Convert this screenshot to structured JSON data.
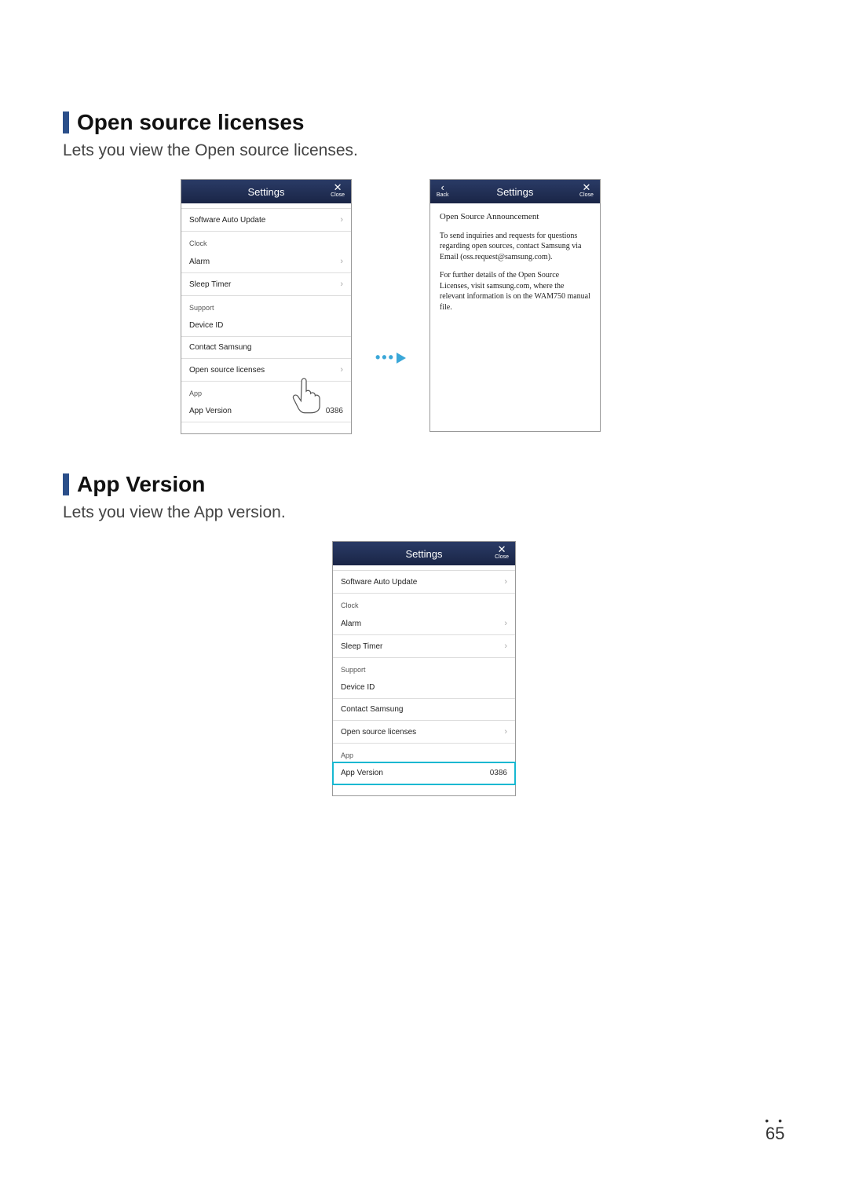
{
  "section1": {
    "title": "Open source licenses",
    "desc": "Lets you view the Open source licenses."
  },
  "section2": {
    "title": "App Version",
    "desc": "Lets you view the App version."
  },
  "settingsScreen": {
    "headerTitle": "Settings",
    "closeLabel": "Close",
    "backLabel": "Back",
    "groups": {
      "g0": {
        "items": {
          "softwareAutoUpdate": "Software Auto Update"
        }
      },
      "clock": {
        "label": "Clock",
        "items": {
          "alarm": "Alarm",
          "sleepTimer": "Sleep Timer"
        }
      },
      "support": {
        "label": "Support",
        "items": {
          "deviceId": "Device ID",
          "contactSamsung": "Contact Samsung",
          "openSource": "Open source licenses"
        }
      },
      "app": {
        "label": "App",
        "items": {
          "appVersion": "App Version",
          "appVersionValue": "0386"
        }
      }
    }
  },
  "ossScreen": {
    "headerTitle": "Settings",
    "announcementTitle": "Open Source Announcement",
    "para1": "To send inquiries and requests for questions regarding open sources, contact Samsung via Email (oss.request@samsung.com).",
    "para2": "For further details of the Open Source Licenses, visit samsung.com, where the relevant information is on the WAM750 manual file."
  },
  "pageNumber": "65"
}
